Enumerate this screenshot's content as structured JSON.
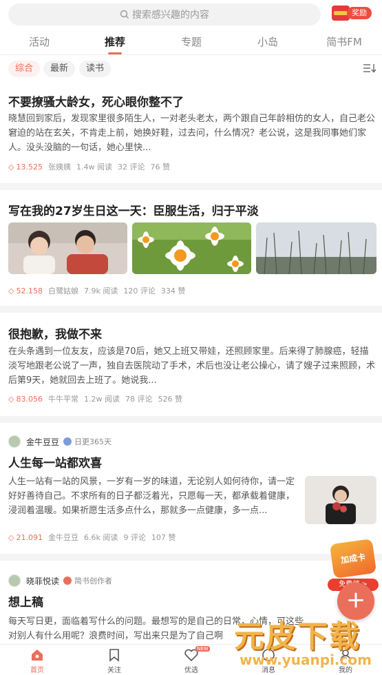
{
  "search": {
    "placeholder": "搜索感兴趣的内容"
  },
  "reward": {
    "label": "奖励"
  },
  "tabs": [
    "活动",
    "推荐",
    "专题",
    "小岛",
    "简书FM"
  ],
  "filters": [
    "综合",
    "最新",
    "读书"
  ],
  "articles": [
    {
      "title": "不要撩骚大龄女，死心眼你整不了",
      "excerpt": "晓慧回到家后，发现家里很多陌生人，一对老头老太，两个跟自己年龄相仿的女人，自己老公窘迫的站在玄关，不肯走上前，她换好鞋，过去问，什么情况？老公说，这是我同事她们家人。没头没脑的一句话，她心里快...",
      "score": "13.525",
      "author": "张姨姨",
      "reads": "1.4w 阅读",
      "comments": "32 评论",
      "likes": "76 赞"
    },
    {
      "title": "写在我的27岁生日这一天：臣服生活，归于平淡",
      "score": "52.158",
      "author": "白鹭姑娘",
      "reads": "7.9k 阅读",
      "comments": "120 评论",
      "likes": "334 赞"
    },
    {
      "title": "很抱歉，我做不来",
      "excerpt": "在头条遇到一位友友，应该是70后，她又上班又带娃，还照顾家里。后来得了肺腺癌，轻描淡写地跟老公说了一声，独自去医院动了手术，术后也没让老公操心，请了嫂子过来照顾，术后第9天，她就回去上班了。她说我...",
      "score": "83.056",
      "author": "牛牛平常",
      "reads": "1.2w 阅读",
      "comments": "78 评论",
      "likes": "526 赞"
    },
    {
      "author_name": "金牛豆豆",
      "author_sub": "日更365天",
      "title": "人生每一站都欢喜",
      "excerpt": "人生一站有一站的风景，一岁有一岁的味道，无论别人如何待你，请一定好好善待自己。不求所有的日子都泛着光，只愿每一天，都承载着健康，浸润着温暖。如果祈愿生活多点什么，那就多一点健康，多一点...",
      "score": "21.091",
      "author": "金牛豆豆",
      "reads": "6.6k 阅读",
      "comments": "9 评论",
      "likes": "107 赞"
    },
    {
      "author_name": "晓菲悦读",
      "author_sub": "简书创作者",
      "title": "想上稿",
      "excerpt": "每天写日更，面临着写什么的问题。最想写的是自己的日常，心情，可这些对别人有什么用呢？浪费时间，写出来只是为了自己啊"
    }
  ],
  "addcard": {
    "title": "加成卡",
    "free": "免费领 >"
  },
  "bottom_nav": [
    "首页",
    "关注",
    "优选",
    "消息",
    "我的"
  ],
  "new_tag": "NEW",
  "watermark": {
    "text": "元皮下载",
    "url": "www.yuanpi.com"
  },
  "colors": {
    "accent": "#ea6f5a",
    "separator": "#f4f4f4"
  }
}
